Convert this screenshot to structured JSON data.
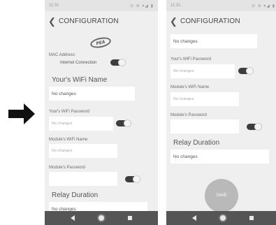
{
  "status_bar": {
    "time": "11:31",
    "icons": "⊙ ⊖ ▾◢ ▮"
  },
  "app_bar": {
    "back_icon": "❮",
    "title": "CONFIGURATION"
  },
  "logo": {
    "icon": "brand-logo-icon",
    "text": "PEA"
  },
  "form": {
    "mac_label": "MAC Address:",
    "internet_label": "Internet Connection",
    "wifi_name_label": "Your's WiFi Name",
    "wifi_name_value": "No changes",
    "wifi_password_label": "Your's WiFi Password",
    "wifi_password_placeholder": "No changes",
    "module_wifi_label": "Module's WiFi Name",
    "module_wifi_placeholder": "No changes",
    "module_password_label": "Module's Password",
    "relay_label": "Relay Duration",
    "relay_value": "No changes"
  },
  "save_label": "SAVE",
  "colors": {
    "background": "#efefef",
    "nav_bar": "#555555",
    "toggle_track": "#3d3d3d",
    "save_button": "#b9b9b9"
  },
  "nav": {
    "back_icon": "triangle-back-icon",
    "home_icon": "circle-home-icon",
    "recent_icon": "square-recent-icon"
  }
}
